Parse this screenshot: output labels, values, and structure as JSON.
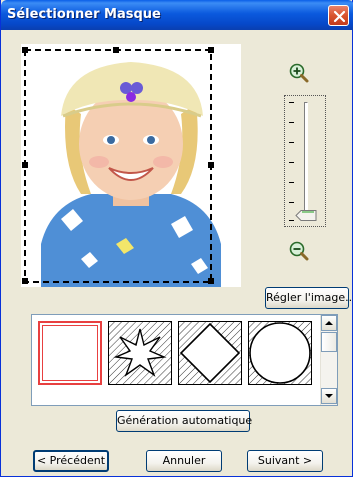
{
  "window": {
    "title": "Sélectionner Masque"
  },
  "zoom": {
    "in_icon": "zoom-in-icon",
    "out_icon": "zoom-out-icon",
    "level": 0
  },
  "buttons": {
    "adjust_image": "Régler l'image...",
    "auto_generate": "Génération automatique",
    "previous": "< Précédent",
    "cancel": "Annuler",
    "next": "Suivant >"
  },
  "masks": [
    {
      "name": "square",
      "selected": true
    },
    {
      "name": "star"
    },
    {
      "name": "diamond"
    },
    {
      "name": "circle"
    }
  ],
  "colors": {
    "title_bar": "#0b5ade",
    "selected_mask_border": "#e84040",
    "window_bg": "#ece9d8"
  }
}
